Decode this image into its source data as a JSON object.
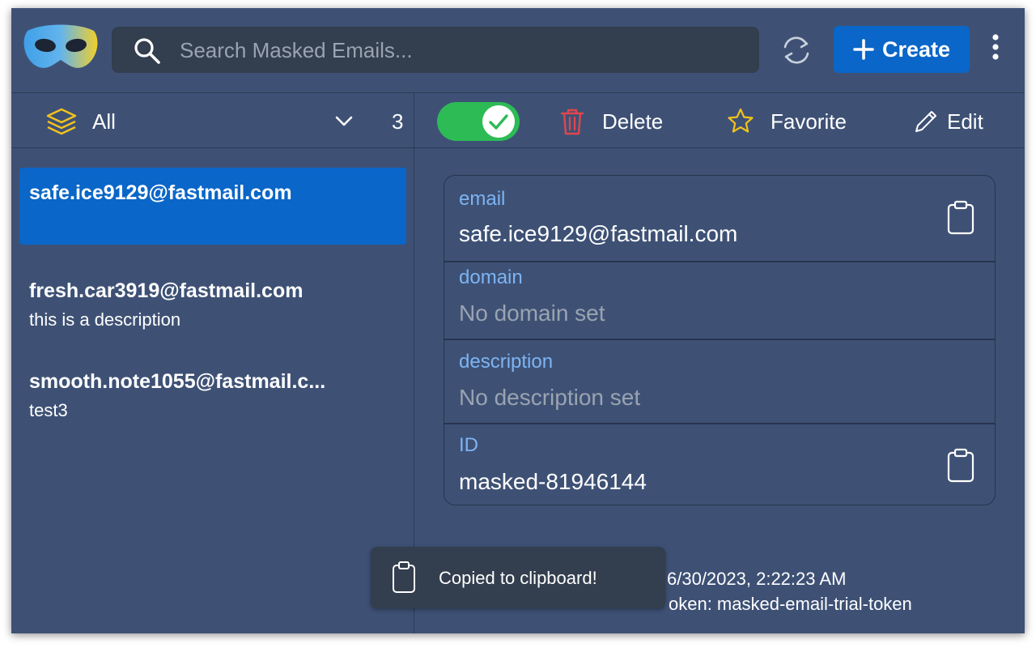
{
  "header": {
    "search": {
      "placeholder": "Search Masked Emails..."
    },
    "create_label": "Create",
    "icons": {
      "logo": "mask-logo",
      "search": "search-icon",
      "refresh": "refresh-icon",
      "create": "plus-icon",
      "menu": "more-vertical-icon"
    }
  },
  "filter": {
    "label": "All",
    "count": "3",
    "icon": "layers-icon"
  },
  "list": {
    "items": [
      {
        "address": "safe.ice9129@fastmail.com",
        "description": "",
        "selected": true
      },
      {
        "address": "fresh.car3919@fastmail.com",
        "description": "this is a description",
        "selected": false
      },
      {
        "address": "smooth.note1055@fastmail.c...",
        "description": "test3",
        "selected": false
      }
    ]
  },
  "toolbar": {
    "enabled": true,
    "delete_label": "Delete",
    "favorite_label": "Favorite",
    "edit_label": "Edit"
  },
  "details": {
    "email": {
      "label": "email",
      "value": "safe.ice9129@fastmail.com"
    },
    "domain": {
      "label": "domain",
      "value": "No domain set"
    },
    "description": {
      "label": "description",
      "value": "No description set"
    },
    "id": {
      "label": "ID",
      "value": "masked-81946144"
    }
  },
  "meta": {
    "created_at_visible": "6/30/2023, 2:22:23 AM",
    "created_by_visible": "oken: masked-email-trial-token"
  },
  "toast": {
    "text": "Copied to clipboard!"
  },
  "colors": {
    "background": "#3e5175",
    "accent": "#0a66c8",
    "toggle_on": "#2dbb56",
    "label": "#7db4f3",
    "delete": "#e0464e",
    "favorite": "#f2c21c"
  }
}
